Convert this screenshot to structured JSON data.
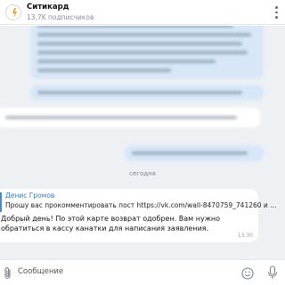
{
  "channel": {
    "name": "Ситикард",
    "subscribers": "13,7K подписчиков"
  },
  "chat": {
    "date_separator": "сегодня",
    "message": {
      "reply_author": "Денис Громов",
      "reply_text": "Прошу вас прокомментировать пост https://vk.com/wall-8470759_741260 и ...",
      "text": "Добрый день! По этой карте возврат одобрен. Вам нужно обратиться в кассу канатки для написания заявления.",
      "time": "13:30"
    }
  },
  "composer": {
    "placeholder": "Сообщение"
  },
  "icons": {
    "menu": "more-vertical-icon",
    "attach": "paperclip-icon",
    "emoji": "smiley-icon",
    "mic": "microphone-icon"
  }
}
